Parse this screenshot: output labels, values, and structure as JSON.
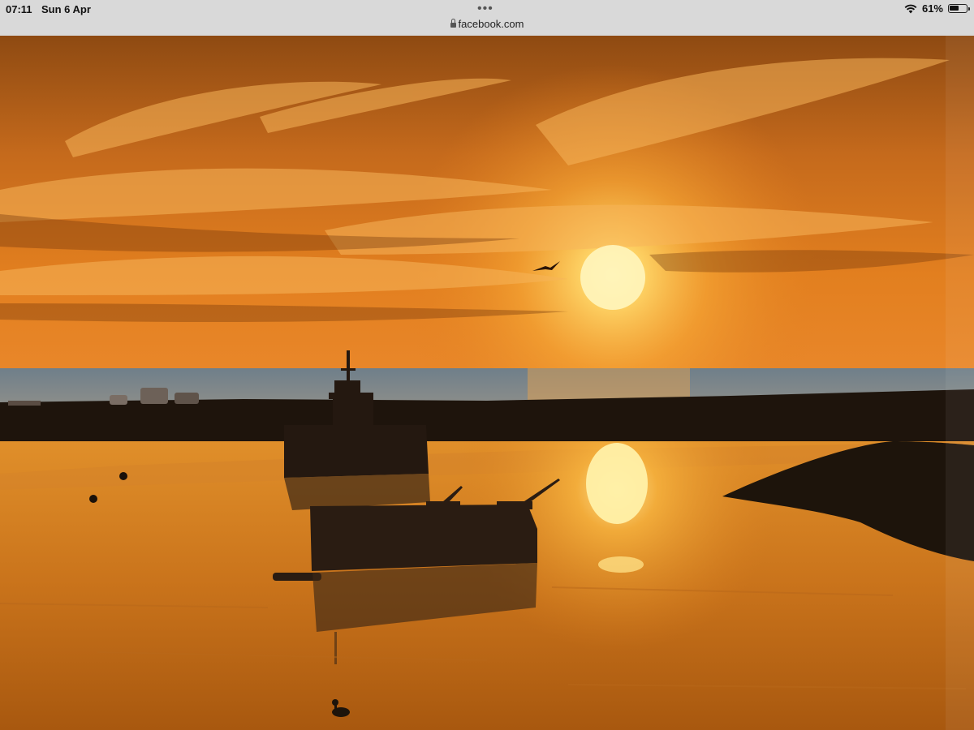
{
  "status_bar": {
    "time": "07:11",
    "date": "Sun 6 Apr",
    "battery_text": "61%",
    "battery_level": 0.61,
    "wifi_icon": "wifi-icon",
    "battery_icon": "battery-icon"
  },
  "browser": {
    "url": "facebook.com",
    "lock_icon": "lock-icon",
    "multitask_icon": "ellipsis-icon"
  },
  "colors": {
    "sky_top": "#9a4f14",
    "sky_glow": "#f6b23a",
    "water": "#d98a22",
    "sun": "#fff2b0",
    "silhouette": "#1c120a"
  }
}
